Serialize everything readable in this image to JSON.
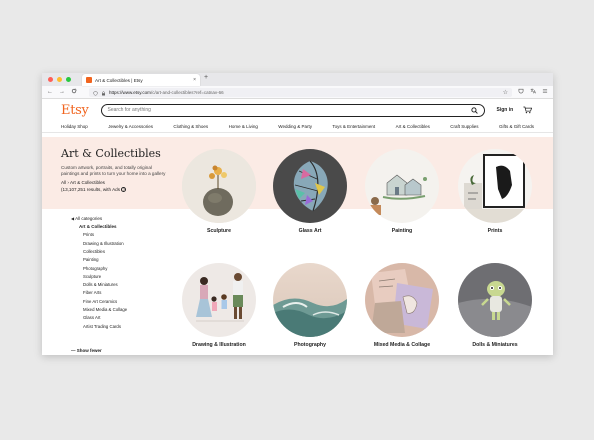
{
  "browser": {
    "tab_title": "Art & Collectibles | Etsy",
    "tab_close": "×",
    "new_tab": "+",
    "url_host": "https://www.etsy.com",
    "url_path": "/c/art-and-collectibles?ref=catnav-66",
    "back": "←",
    "forward": "→",
    "reload": "C",
    "star": "☆"
  },
  "header": {
    "logo": "Etsy",
    "search_placeholder": "Search for anything",
    "sign_in": "Sign in"
  },
  "catnav": [
    "Holiday Shop",
    "Jewelry & Accessories",
    "Clothing & Shoes",
    "Home & Living",
    "Wedding & Party",
    "Toys & Entertainment",
    "Art & Collectibles",
    "Craft Supplies",
    "Gifts & Gift Cards"
  ],
  "page": {
    "title": "Art & Collectibles",
    "description": "Custom artwork, portraits, and totally original paintings and prints to turn your home into a gallery",
    "breadcrumb_all": "All",
    "breadcrumb_sep": "›",
    "breadcrumb_current": "Art & Collectibles",
    "results": "(13,107,251 results, with Ads",
    "ads_icon": "?"
  },
  "sidebar": {
    "all_label": "All categories",
    "active": "Art & Collectibles",
    "items": [
      "Prints",
      "Drawing & Illustration",
      "Collectibles",
      "Painting",
      "Photography",
      "Sculpture",
      "Dolls & Miniatures",
      "Fiber Arts",
      "Fine Art Ceramics",
      "Mixed Media & Collage",
      "Glass Art",
      "Artist Trading Cards"
    ],
    "show_fewer": "Show fewer"
  },
  "categories": [
    {
      "label": "Sculpture"
    },
    {
      "label": "Glass Art"
    },
    {
      "label": "Painting"
    },
    {
      "label": "Prints"
    },
    {
      "label": "Drawing & Illustration"
    },
    {
      "label": "Photography"
    },
    {
      "label": "Mixed Media & Collage"
    },
    {
      "label": "Dolls & Miniatures"
    }
  ],
  "colors": {
    "brand": "#f1641e",
    "hero_bg": "#fbebe5"
  }
}
